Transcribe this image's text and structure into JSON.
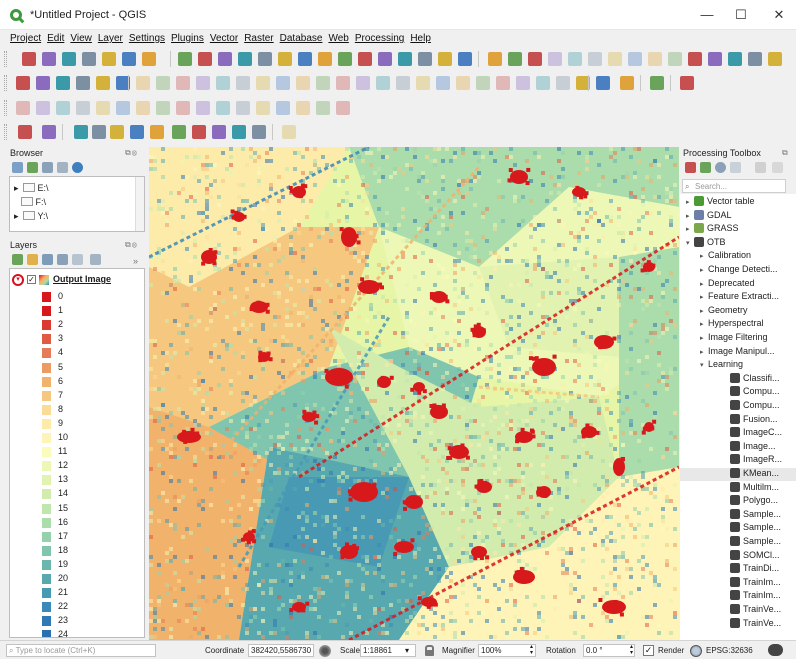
{
  "window": {
    "title": "*Untitled Project - QGIS",
    "minimize": "—",
    "maximize": "☐",
    "close": "✕"
  },
  "menu": [
    "Project",
    "Edit",
    "View",
    "Layer",
    "Settings",
    "Plugins",
    "Vector",
    "Raster",
    "Database",
    "Web",
    "Processing",
    "Help"
  ],
  "browser": {
    "title": "Browser",
    "items": [
      {
        "label": "E:\\"
      },
      {
        "label": "F:\\"
      },
      {
        "label": "Y:\\"
      }
    ]
  },
  "layers": {
    "title": "Layers",
    "layer_name": "Output Image",
    "classes": [
      "0",
      "1",
      "2",
      "3",
      "4",
      "5",
      "6",
      "7",
      "8",
      "9",
      "10",
      "11",
      "12",
      "13",
      "14",
      "15",
      "16",
      "17",
      "18",
      "19",
      "20",
      "21",
      "22",
      "23",
      "24"
    ],
    "class_colors": [
      "#d7191c",
      "#d7191c",
      "#db3a30",
      "#e05a44",
      "#e57b58",
      "#ec9c63",
      "#f1b26b",
      "#f6c77e",
      "#fbdc96",
      "#fdebaa",
      "#fff4b8",
      "#fafcbc",
      "#eef8b6",
      "#e2f2b1",
      "#d2ecae",
      "#c0e5ad",
      "#abdcac",
      "#96d1ad",
      "#80c5ae",
      "#6bb7ad",
      "#58a8b0",
      "#4899b4",
      "#3a89b8",
      "#2f79b5",
      "#2b6fae"
    ]
  },
  "toolbox": {
    "title": "Processing Toolbox",
    "search_placeholder": "Search...",
    "tree": [
      {
        "label": "Vector table",
        "arrow": "▸",
        "level": 0,
        "icon": "#4a9a35"
      },
      {
        "label": "GDAL",
        "arrow": "▸",
        "level": 0,
        "icon": "#6b7fa8"
      },
      {
        "label": "GRASS",
        "arrow": "▸",
        "level": 0,
        "icon": "#7aa84a"
      },
      {
        "label": "OTB",
        "arrow": "▾",
        "level": 0,
        "icon": "#444444"
      },
      {
        "label": "Calibration",
        "arrow": "▸",
        "level": 1
      },
      {
        "label": "Change Detecti...",
        "arrow": "▸",
        "level": 1
      },
      {
        "label": "Deprecated",
        "arrow": "▸",
        "level": 1
      },
      {
        "label": "Feature Extracti...",
        "arrow": "▸",
        "level": 1
      },
      {
        "label": "Geometry",
        "arrow": "▸",
        "level": 1
      },
      {
        "label": "Hyperspectral",
        "arrow": "▸",
        "level": 1
      },
      {
        "label": "Image Filtering",
        "arrow": "▸",
        "level": 1
      },
      {
        "label": "Image Manipul...",
        "arrow": "▸",
        "level": 1
      },
      {
        "label": "Learning",
        "arrow": "▾",
        "level": 1
      },
      {
        "label": "Classifi...",
        "level": 2,
        "icon": "#444444"
      },
      {
        "label": "Compu...",
        "level": 2,
        "icon": "#444444"
      },
      {
        "label": "Compu...",
        "level": 2,
        "icon": "#444444"
      },
      {
        "label": "Fusion...",
        "level": 2,
        "icon": "#444444"
      },
      {
        "label": "ImageC...",
        "level": 2,
        "icon": "#444444"
      },
      {
        "label": "Image...",
        "level": 2,
        "icon": "#444444"
      },
      {
        "label": "ImageR...",
        "level": 2,
        "icon": "#444444"
      },
      {
        "label": "KMean...",
        "level": 2,
        "icon": "#444444",
        "selected": true
      },
      {
        "label": "Multilm...",
        "level": 2,
        "icon": "#444444"
      },
      {
        "label": "Polygo...",
        "level": 2,
        "icon": "#444444"
      },
      {
        "label": "Sample...",
        "level": 2,
        "icon": "#444444"
      },
      {
        "label": "Sample...",
        "level": 2,
        "icon": "#444444"
      },
      {
        "label": "Sample...",
        "level": 2,
        "icon": "#444444"
      },
      {
        "label": "SOMCl...",
        "level": 2,
        "icon": "#444444"
      },
      {
        "label": "TrainDi...",
        "level": 2,
        "icon": "#444444"
      },
      {
        "label": "TrainIm...",
        "level": 2,
        "icon": "#444444"
      },
      {
        "label": "TrainIm...",
        "level": 2,
        "icon": "#444444"
      },
      {
        "label": "TrainVe...",
        "level": 2,
        "icon": "#444444"
      },
      {
        "label": "TrainVe...",
        "level": 2,
        "icon": "#444444"
      }
    ]
  },
  "status": {
    "locate_placeholder": "Type to locate (Ctrl+K)",
    "coordinate_label": "Coordinate",
    "coordinate_value": "382420,5586730",
    "scale_label": "Scale",
    "scale_value": "1:18861",
    "magnifier_label": "Magnifier",
    "magnifier_value": "100%",
    "rotation_label": "Rotation",
    "rotation_value": "0.0 °",
    "render_label": "Render",
    "crs_label": "EPSG:32636"
  }
}
